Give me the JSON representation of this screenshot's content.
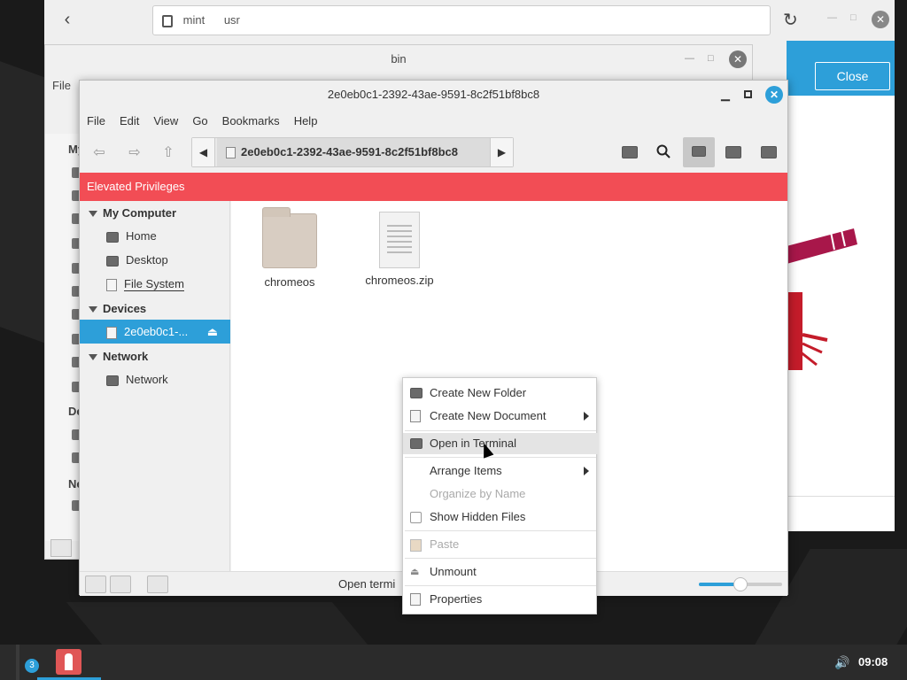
{
  "browser": {
    "url_parts": [
      "mint",
      "usr"
    ],
    "close_label": "Close"
  },
  "bin_window": {
    "title": "bin",
    "menu_file": "File",
    "side_labels": [
      "My",
      "De",
      "Ne"
    ]
  },
  "file_manager": {
    "title": "2e0eb0c1-2392-43ae-9591-8c2f51bf8bc8",
    "menu": [
      "File",
      "Edit",
      "View",
      "Go",
      "Bookmarks",
      "Help"
    ],
    "path": "2e0eb0c1-2392-43ae-9591-8c2f51bf8bc8",
    "banner": "Elevated Privileges",
    "sidebar": {
      "my_computer": "My Computer",
      "home": "Home",
      "desktop": "Desktop",
      "filesystem": "File System",
      "devices": "Devices",
      "device_item": "2e0eb0c1-...",
      "network_head": "Network",
      "network_item": "Network"
    },
    "files": [
      {
        "name": "chromeos",
        "type": "folder"
      },
      {
        "name": "chromeos.zip",
        "type": "zip"
      }
    ],
    "status_text": "Open termi",
    "zoom_level": 0.5
  },
  "context_menu": {
    "create_folder": "Create New Folder",
    "create_doc": "Create New Document",
    "open_terminal": "Open in Terminal",
    "arrange": "Arrange Items",
    "organize": "Organize by Name",
    "show_hidden": "Show Hidden Files",
    "paste": "Paste",
    "unmount": "Unmount",
    "properties": "Properties"
  },
  "taskbar": {
    "workspace_badge": "3",
    "clock": "09:08"
  },
  "colors": {
    "accent": "#2d9fd9",
    "banner": "#f24d55"
  }
}
